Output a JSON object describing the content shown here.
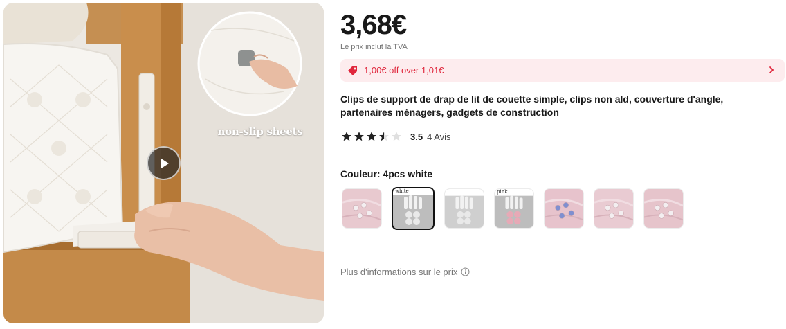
{
  "media": {
    "caption": "non-slip sheets"
  },
  "product": {
    "price": "3,68€",
    "vat_note": "Le prix inclut la TVA",
    "coupon_text": "1,00€ off over 1,01€",
    "title_line1": "Clips de support de drap de lit de couette simple, clips non ald, couverture d'angle,",
    "title_line2": "partenaires ménagers, gadgets de construction",
    "rating_score": "3.5",
    "rating_value": 3.5,
    "rating_max": 5,
    "review_count": "4 Avis",
    "color_label": "Couleur: 4pcs white",
    "more_info": "Plus d'informations sur le prix"
  },
  "swatches": [
    {
      "label": "",
      "selected": false,
      "bg": "#e8c9cf"
    },
    {
      "label": "white",
      "selected": true,
      "bg": "#bdbdbd"
    },
    {
      "label": "",
      "selected": false,
      "bg": "#cfcfcf"
    },
    {
      "label": "pink",
      "selected": false,
      "bg": "#bdbdbd"
    },
    {
      "label": "",
      "selected": false,
      "bg": "#e7c3cc"
    },
    {
      "label": "",
      "selected": false,
      "bg": "#e9cbd2"
    },
    {
      "label": "",
      "selected": false,
      "bg": "#e6c4cb"
    }
  ],
  "colors": {
    "accent_red": "#e0263c",
    "coupon_bg": "#fdecee",
    "text_primary": "#191919",
    "text_muted": "#757575"
  }
}
